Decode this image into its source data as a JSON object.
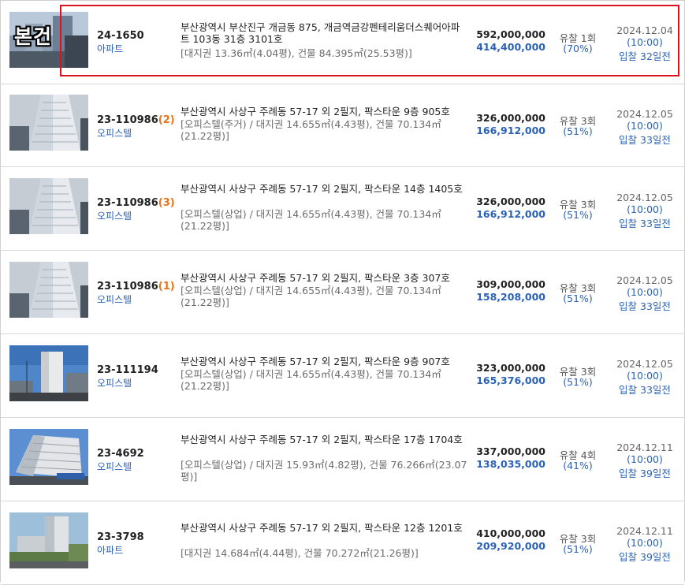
{
  "colors": {
    "accent_blue": "#2a62b8",
    "suffix_orange": "#e8731a",
    "highlight_red": "#d9121f"
  },
  "main_badge": "본건",
  "rows": [
    {
      "case_no": "24-1650",
      "case_suffix": "",
      "type": "아파트",
      "address": "부산광역시 부산진구 개금동 875, 개금역금강펜테리움더스퀘어아파트 103동 31층 3101호",
      "detail": "[대지권 13.36㎡(4.04평), 건물 84.395㎡(25.53평)]",
      "appraised": "592,000,000",
      "minimum": "414,400,000",
      "status": "유찰 1회",
      "ratio": "(70%)",
      "date": "2024.12.04",
      "time": "(10:00)",
      "dday": "입찰 32일전"
    },
    {
      "case_no": "23-110986",
      "case_suffix": "(2)",
      "type": "오피스텔",
      "address": "부산광역시 사상구 주례동 57-17 외 2필지, 팍스타운 9층 905호",
      "detail": "[오피스텔(주거) / 대지권 14.655㎡(4.43평), 건물 70.134㎡(21.22평)]",
      "appraised": "326,000,000",
      "minimum": "166,912,000",
      "status": "유찰 3회",
      "ratio": "(51%)",
      "date": "2024.12.05",
      "time": "(10:00)",
      "dday": "입찰 33일전"
    },
    {
      "case_no": "23-110986",
      "case_suffix": "(3)",
      "type": "오피스텔",
      "address": "부산광역시 사상구 주례동 57-17 외 2필지, 팍스타운 14층 1405호",
      "detail": "[오피스텔(상업) / 대지권 14.655㎡(4.43평), 건물 70.134㎡(21.22평)]",
      "appraised": "326,000,000",
      "minimum": "166,912,000",
      "status": "유찰 3회",
      "ratio": "(51%)",
      "date": "2024.12.05",
      "time": "(10:00)",
      "dday": "입찰 33일전"
    },
    {
      "case_no": "23-110986",
      "case_suffix": "(1)",
      "type": "오피스텔",
      "address": "부산광역시 사상구 주례동 57-17 외 2필지, 팍스타운 3층 307호",
      "detail": "[오피스텔(상업) / 대지권 14.655㎡(4.43평), 건물 70.134㎡(21.22평)]",
      "appraised": "309,000,000",
      "minimum": "158,208,000",
      "status": "유찰 3회",
      "ratio": "(51%)",
      "date": "2024.12.05",
      "time": "(10:00)",
      "dday": "입찰 33일전"
    },
    {
      "case_no": "23-111194",
      "case_suffix": "",
      "type": "오피스텔",
      "address": "부산광역시 사상구 주례동 57-17 외 2필지, 팍스타운 9층 907호",
      "detail": "[오피스텔(상업) / 대지권 14.655㎡(4.43평), 건물 70.134㎡(21.22평)]",
      "appraised": "323,000,000",
      "minimum": "165,376,000",
      "status": "유찰 3회",
      "ratio": "(51%)",
      "date": "2024.12.05",
      "time": "(10:00)",
      "dday": "입찰 33일전"
    },
    {
      "case_no": "23-4692",
      "case_suffix": "",
      "type": "오피스텔",
      "address": "부산광역시 사상구 주례동 57-17 외 2필지, 팍스타운 17층 1704호",
      "detail": "[오피스텔(상업) / 대지권 15.93㎡(4.82평), 건물 76.266㎡(23.07평)]",
      "appraised": "337,000,000",
      "minimum": "138,035,000",
      "status": "유찰 4회",
      "ratio": "(41%)",
      "date": "2024.12.11",
      "time": "(10:00)",
      "dday": "입찰 39일전"
    },
    {
      "case_no": "23-3798",
      "case_suffix": "",
      "type": "아파트",
      "address": "부산광역시 사상구 주례동 57-17 외 2필지, 팍스타운 12층 1201호",
      "detail": "[대지권 14.684㎡(4.44평), 건물 70.272㎡(21.26평)]",
      "appraised": "410,000,000",
      "minimum": "209,920,000",
      "status": "유찰 3회",
      "ratio": "(51%)",
      "date": "2024.12.11",
      "time": "(10:00)",
      "dday": "입찰 39일전"
    }
  ]
}
